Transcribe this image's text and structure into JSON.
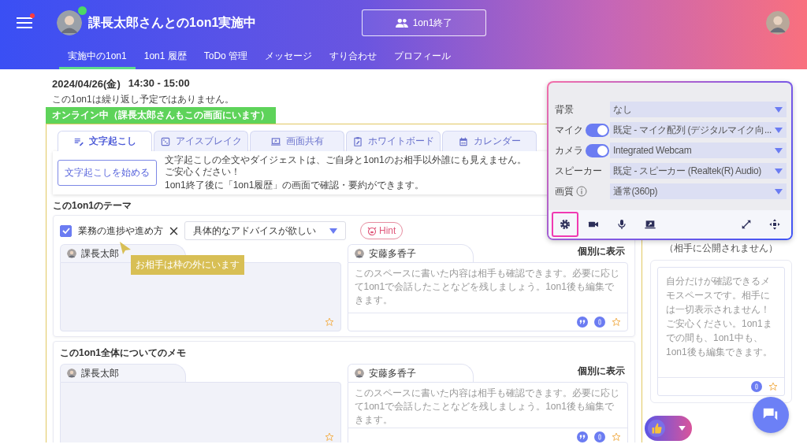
{
  "header": {
    "menu_notification": true,
    "partner_online": true,
    "title": "課長太郎さんとの1on1実施中",
    "end_button": "1on1終了"
  },
  "nav": [
    {
      "label": "実施中の1on1",
      "selected": true
    },
    {
      "label": "1on1 履歴",
      "selected": false
    },
    {
      "label": "ToDo 管理",
      "selected": false
    },
    {
      "label": "メッセージ",
      "selected": false
    },
    {
      "label": "すり合わせ",
      "selected": false
    },
    {
      "label": "プロフィール",
      "selected": false
    }
  ],
  "schedule": {
    "date": "2024/04/26(金)",
    "time": "14:30 - 15:00",
    "recurrence": "この1on1は繰り返し予定ではありません。"
  },
  "presence": "オンライン中（課長太郎さんもこの画面にいます）",
  "tool_tabs": [
    {
      "kind": "transcript",
      "label": "文字起こし",
      "selected": true
    },
    {
      "kind": "icebreak",
      "label": "アイスブレイク",
      "selected": false
    },
    {
      "kind": "screen",
      "label": "画面共有",
      "selected": false
    },
    {
      "kind": "whiteboard",
      "label": "ホワイトボード",
      "selected": false
    },
    {
      "kind": "calendar",
      "label": "カレンダー",
      "selected": false
    }
  ],
  "transcription": {
    "button": "文字起こしを始める",
    "lines": [
      "文字起こしの全文やダイジェストは、ご自身と1on1のお相手以外誰にも見えません。ご安心ください！",
      "1on1終了後に「1on1履歴」の画面で確認・要約ができます。"
    ]
  },
  "theme": {
    "heading": "この1on1のテーマ",
    "topic": {
      "label": "業務の進捗や進め方",
      "checked": true
    },
    "request": "具体的なアドバイスが欲しい",
    "hint": "Hint",
    "tooltip": "お相手は枠の外にいます",
    "notes": [
      {
        "author": "課長太郎",
        "editable": false
      },
      {
        "author": "安藤多香子",
        "editable": true,
        "show_label": "個別に表示",
        "placeholder": "このスペースに書いた内容は相手も確認できます。必要に応じて1on1で会話したことなどを残しましょう。1on1後も編集できます。"
      }
    ]
  },
  "overall_memo": {
    "heading": "この1on1全体についてのメモ",
    "notes": [
      {
        "author": "課長太郎",
        "editable": false
      },
      {
        "author": "安藤多香子",
        "editable": true,
        "show_label": "個別に表示",
        "placeholder": "このスペースに書いた内容は相手も確認できます。必要に応じて1on1で会話したことなどを残しましょう。1on1後も編集できます。"
      }
    ]
  },
  "private_memo": {
    "caption": "（相手に公開されません）",
    "placeholder": "自分だけが確認できるメモスペースです。相手には一切表示されません！ご安心ください。1on1までの間も、1on1中も、1on1後も編集できます。"
  },
  "device_settings": {
    "rows": [
      {
        "kind": "select",
        "label": "背景",
        "value": "なし"
      },
      {
        "kind": "toggle",
        "label": "マイク",
        "on": true,
        "value": "既定 - マイク配列 (デジタルマイク向..."
      },
      {
        "kind": "toggle",
        "label": "カメラ",
        "on": true,
        "value": "Integrated Webcam"
      },
      {
        "kind": "select",
        "label": "スピーカー",
        "value": "既定 - スピーカー (Realtek(R) Audio)"
      },
      {
        "kind": "info",
        "label": "画質",
        "value": "通常(360p)"
      }
    ],
    "controls": [
      {
        "kind": "settings",
        "highlighted": true
      },
      {
        "kind": "camera",
        "highlighted": false
      },
      {
        "kind": "mic",
        "highlighted": false
      },
      {
        "kind": "share",
        "highlighted": false
      }
    ],
    "window_controls": [
      {
        "kind": "expand"
      },
      {
        "kind": "move"
      }
    ]
  }
}
